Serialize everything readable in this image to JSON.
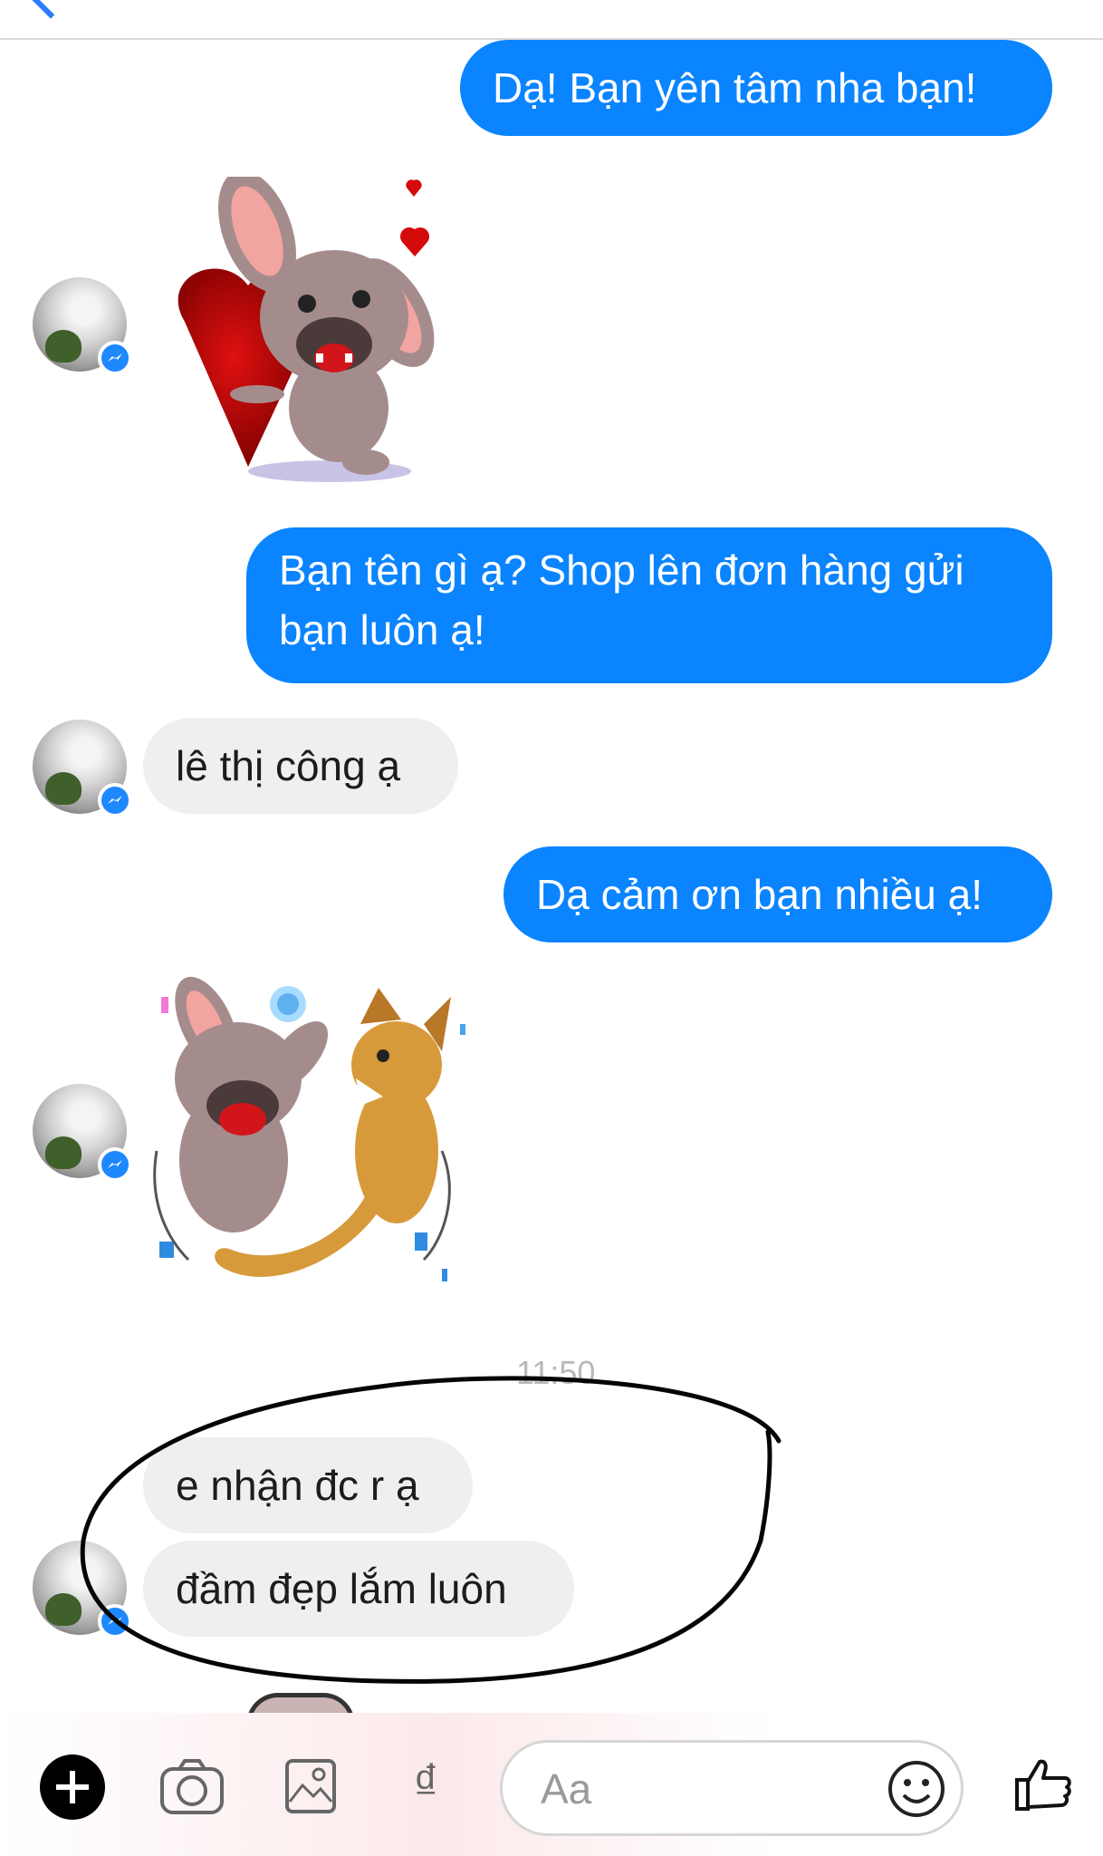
{
  "messages": [
    {
      "side": "out",
      "text": "Dạ! Bạn yên tâm nha bạn!"
    },
    {
      "side": "in",
      "type": "sticker",
      "icon": "dog-heart-sticker"
    },
    {
      "side": "out",
      "text": "Bạn tên gì ạ? Shop lên đơn hàng gửi bạn luôn ạ!"
    },
    {
      "side": "in",
      "text": "lê thị công ạ"
    },
    {
      "side": "out",
      "text": "Dạ cảm ơn bạn nhiều ạ!"
    },
    {
      "side": "in",
      "type": "sticker",
      "icon": "dog-cat-dance-sticker"
    },
    {
      "side": "in",
      "text": "e nhận đc r ạ"
    },
    {
      "side": "in",
      "text": "đầm đẹp lắm luôn"
    }
  ],
  "msg": {
    "m1": "Dạ! Bạn yên tâm nha bạn!",
    "m2_line1": "Bạn tên gì ạ? Shop lên đơn hàng gửi",
    "m2_line2": "bạn luôn ạ!",
    "m3": "lê thị công ạ",
    "m4": "Dạ cảm ơn bạn nhiều ạ!",
    "m5": "e nhận đc r ạ",
    "m6": "đầm đẹp lắm luôn"
  },
  "timestamp": "11:50",
  "composer": {
    "placeholder": "Aa",
    "dong_symbol": "₫",
    "icons": [
      "plus-icon",
      "camera-icon",
      "photo-icon",
      "dong-icon",
      "emoji-icon",
      "thumbs-up-icon"
    ]
  },
  "colors": {
    "outgoing": "#0a84ff",
    "incoming": "#efefef",
    "badge": "#1e88ff"
  }
}
